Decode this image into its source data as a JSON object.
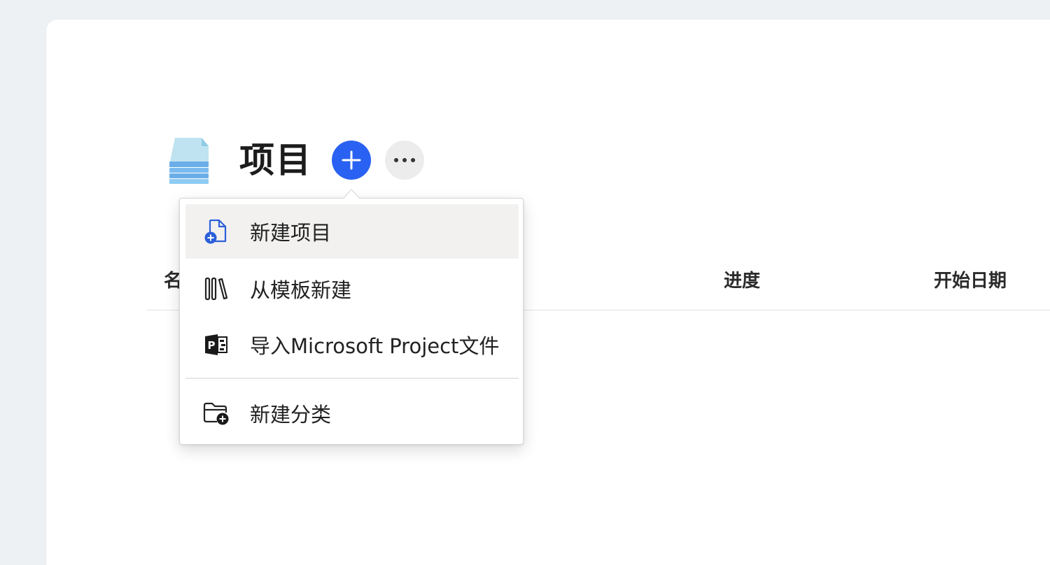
{
  "page": {
    "title": "项目",
    "add_button_icon": "plus-icon",
    "more_button_icon": "ellipsis-icon",
    "header_icon": "stacked-documents-icon"
  },
  "table": {
    "columns": [
      {
        "label": "名"
      },
      {
        "label": "进度"
      },
      {
        "label": "开始日期"
      }
    ]
  },
  "menu": {
    "items": [
      {
        "label": "新建项目",
        "icon": "new-document-icon",
        "active": true
      },
      {
        "label": "从模板新建",
        "icon": "template-library-icon",
        "active": false
      },
      {
        "label": "导入Microsoft Project文件",
        "icon": "microsoft-project-icon",
        "active": false
      },
      {
        "label": "新建分类",
        "icon": "new-folder-icon",
        "active": false
      }
    ]
  },
  "colors": {
    "accent": "#2962f2",
    "panel_background": "#ffffff",
    "page_background": "#eef1f4",
    "menu_active": "#f2f1f0"
  }
}
